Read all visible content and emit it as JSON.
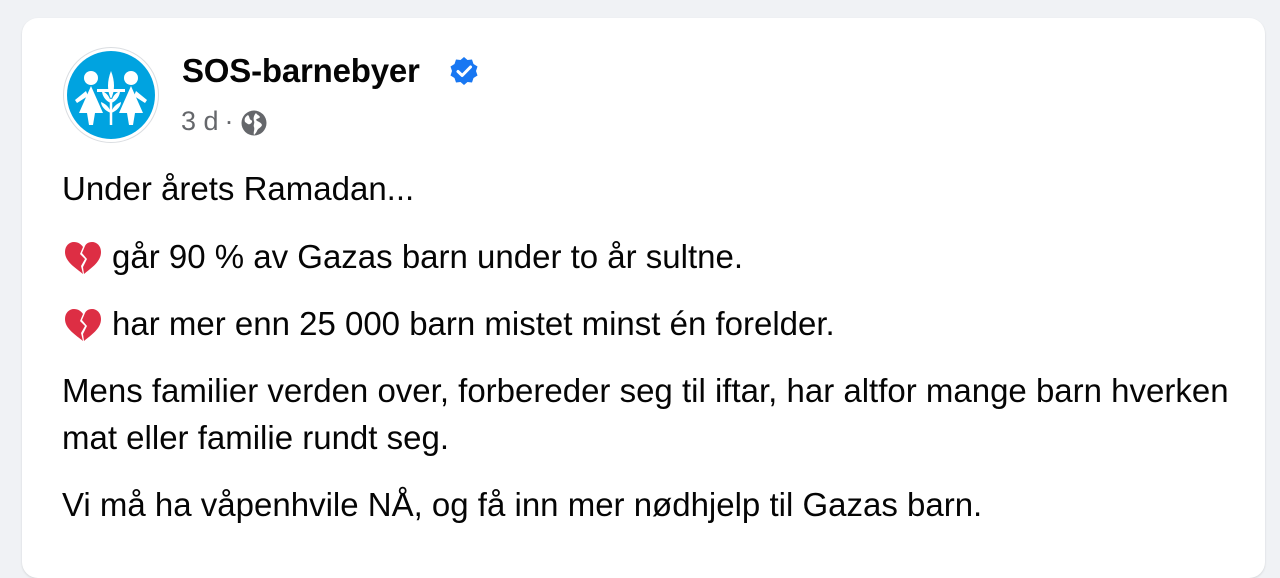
{
  "post": {
    "author": "SOS-barnebyer",
    "verified": true,
    "time": "3 d",
    "separator": "·",
    "audience_icon": "globe-icon",
    "paragraphs": {
      "intro": "Under årets Ramadan...",
      "line1": "går 90 % av Gazas barn under to år sultne.",
      "line2": "har mer enn 25 000 barn mistet minst én forelder.",
      "line3": "Mens familier verden over, forbereder seg til iftar, har altfor mange barn hverken mat eller familie rundt seg.",
      "line4": "Vi må ha våpenhvile NÅ, og få inn mer nødhjelp til Gazas barn."
    },
    "emoji": "broken-heart-icon",
    "colors": {
      "verified_blue": "#1877f2",
      "logo_blue": "#00a3e0",
      "heart_red": "#dd2e44",
      "meta_gray": "#65676b"
    }
  }
}
